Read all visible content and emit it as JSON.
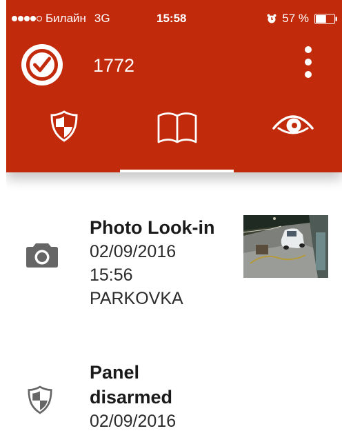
{
  "colors": {
    "appbar": "#c22a0c",
    "text": "#1a1a1a",
    "icon_gray": "#666666"
  },
  "statusbar": {
    "carrier": "Билайн",
    "network": "3G",
    "time": "15:58",
    "battery": "57 %",
    "battery_level": 0.57
  },
  "appbar": {
    "account_number": "1772",
    "icons": {
      "check": "check-circle-icon",
      "menu": "more-vertical-icon"
    }
  },
  "tabs": [
    {
      "name": "security",
      "icon": "shield-icon",
      "selected": false
    },
    {
      "name": "events",
      "icon": "book-icon",
      "selected": true
    },
    {
      "name": "look-in",
      "icon": "eye-icon",
      "selected": false
    }
  ],
  "events": [
    {
      "icon": "camera-icon",
      "title": "Photo Look-in",
      "date": "02/09/2016",
      "time": "15:56",
      "location": "PARKOVKA",
      "thumbnail": "parking-lot-photo"
    },
    {
      "icon": "shield-icon",
      "title_line1": "Panel",
      "title_line2": "disarmed",
      "date": "02/09/2016"
    }
  ]
}
